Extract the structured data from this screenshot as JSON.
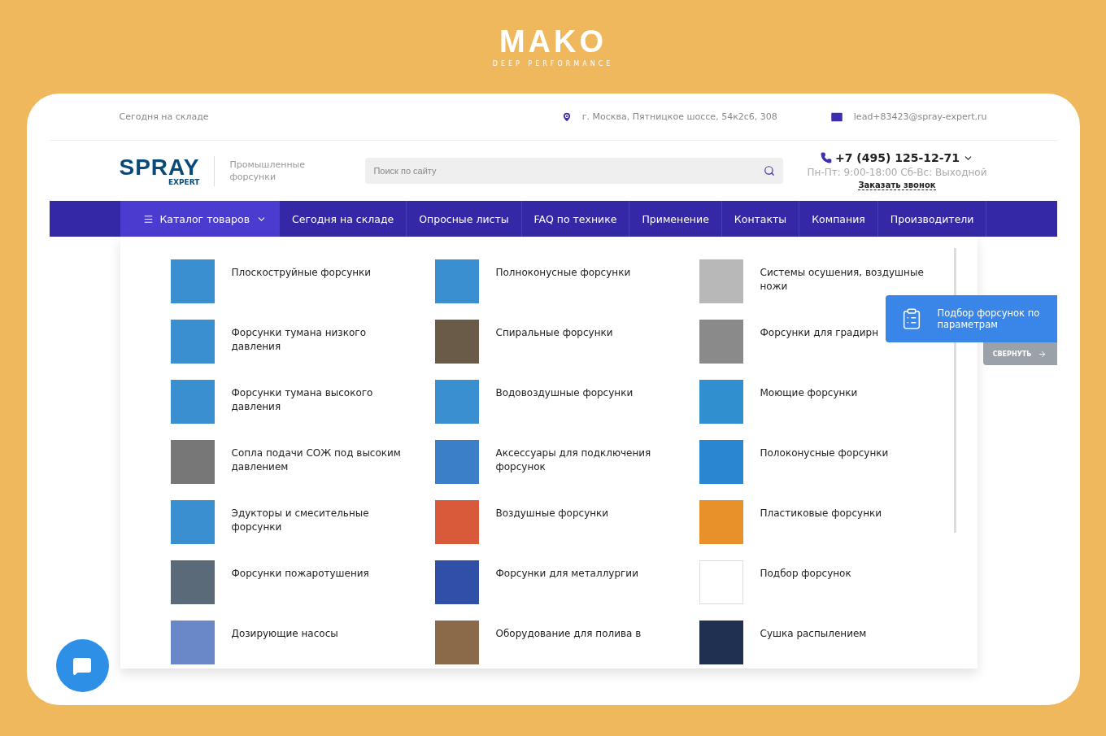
{
  "brand": {
    "name": "MAKO",
    "tagline": "DEEP PERFORMANCE"
  },
  "topbar": {
    "link": "Сегодня на складе",
    "address": "г. Москва, Пятницкое шоссе, 54к2с6, 308",
    "email": "lead+83423@spray-expert.ru"
  },
  "header": {
    "logo": {
      "word": "SPRAY",
      "sub": "EXPERT"
    },
    "tagline": "Промышленные форсунки",
    "search": {
      "placeholder": "Поиск по сайту"
    },
    "phone": "+7 (495) 125-12-71",
    "hours": "Пн-Пт: 9:00-18:00 Сб-Вс: Выходной",
    "callback": "Заказать звонок"
  },
  "nav": [
    {
      "label": "Каталог товаров",
      "selected": true,
      "kind": "catalog"
    },
    {
      "label": "Сегодня на складе",
      "selected": false,
      "kind": "link"
    },
    {
      "label": "Опросные листы",
      "selected": false,
      "kind": "link"
    },
    {
      "label": "FAQ по технике",
      "selected": false,
      "kind": "link"
    },
    {
      "label": "Применение",
      "selected": false,
      "kind": "link"
    },
    {
      "label": "Контакты",
      "selected": false,
      "kind": "link"
    },
    {
      "label": "Компания",
      "selected": false,
      "kind": "link"
    },
    {
      "label": "Производители",
      "selected": false,
      "kind": "link"
    }
  ],
  "catalog": [
    {
      "label": "Плоскоструйные форсунки",
      "color": "#3a8fd0"
    },
    {
      "label": "Полноконусные форсунки",
      "color": "#3a8fd0"
    },
    {
      "label": "Системы осушения, воздушные ножи",
      "color": "#b8b8b8"
    },
    {
      "label": "Форсунки тумана низкого давления",
      "color": "#3a8fd0"
    },
    {
      "label": "Спиральные форсунки",
      "color": "#6a5a48"
    },
    {
      "label": "Форсунки для градирн",
      "color": "#8a8a8a"
    },
    {
      "label": "Форсунки тумана высокого давления",
      "color": "#3a8fd0"
    },
    {
      "label": "Водовоздушные форсунки",
      "color": "#3a8fd0"
    },
    {
      "label": "Моющие форсунки",
      "color": "#2f8fcf"
    },
    {
      "label": "Сопла подачи СОЖ под высоким давлением",
      "color": "#777777"
    },
    {
      "label": "Аксессуары для подключения форсунок",
      "color": "#3a7fc8"
    },
    {
      "label": "Полоконусные форсунки",
      "color": "#2b86d1"
    },
    {
      "label": "Эдукторы и смесительные форсунки",
      "color": "#3a8fd0"
    },
    {
      "label": "Воздушные форсунки",
      "color": "#d85a3a"
    },
    {
      "label": "Пластиковые форсунки",
      "color": "#e8902a"
    },
    {
      "label": "Форсунки пожаротушения",
      "color": "#5a6a78"
    },
    {
      "label": "Форсунки для металлургии",
      "color": "#3050a8"
    },
    {
      "label": "Подбор форсунок",
      "color": "#ffffff"
    },
    {
      "label": "Дозирующие насосы",
      "color": "#6a88c8"
    },
    {
      "label": "Оборудование для полива в",
      "color": "#8a6a48"
    },
    {
      "label": "Сушка распылением",
      "color": "#203050"
    }
  ],
  "widget": {
    "title": "Подбор форсунок по параметрам",
    "collapse": "СВЕРНУТЬ"
  }
}
